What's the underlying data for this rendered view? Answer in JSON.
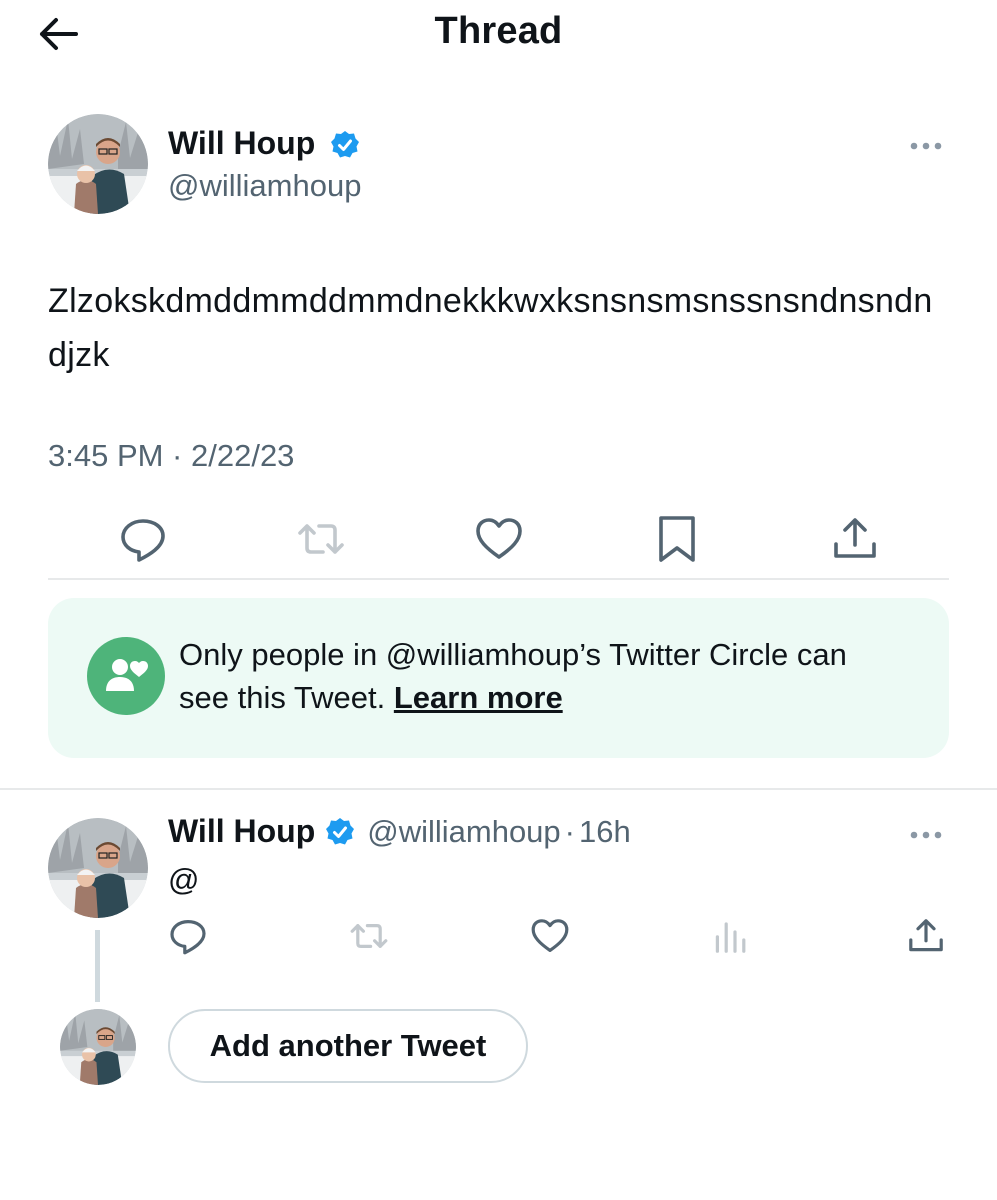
{
  "header": {
    "title": "Thread",
    "back_icon": "arrow-left-icon"
  },
  "main_tweet": {
    "author_name": "Will Houp",
    "author_handle": "@williamhoup",
    "verified_icon": "verified-badge-icon",
    "text": "Zlzokskdmddmmddmmdnekkkwxksnsnsmsnssnsndnsndndjzk",
    "timestamp": "3:45 PM · 2/22/23",
    "actions": [
      "reply-icon",
      "retweet-icon",
      "like-icon",
      "bookmark-icon",
      "share-icon"
    ]
  },
  "circle_notice": {
    "text": "Only people in @williamhoup’s Twitter Circle can see this Tweet.",
    "link_label": "Learn more",
    "icon": "twitter-circle-icon"
  },
  "reply_tweet": {
    "author_name": "Will Houp",
    "author_handle": "@williamhoup",
    "separator": "·",
    "age": "16h",
    "text": "@",
    "actions": [
      "reply-icon",
      "retweet-icon",
      "like-icon",
      "analytics-icon",
      "share-icon"
    ]
  },
  "composer": {
    "add_label": "Add another Tweet"
  },
  "colors": {
    "text": "#0f1419",
    "secondary": "#536471",
    "verified": "#1d9bf0",
    "circle_bg": "#edfaf5",
    "circle_icon": "#4eb47a"
  }
}
